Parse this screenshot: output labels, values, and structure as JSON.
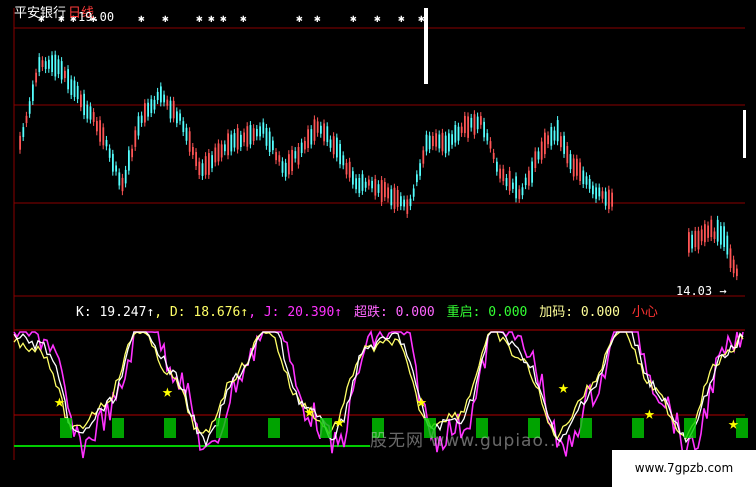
{
  "chart_title": "平安银行",
  "period": "日线",
  "price_high_label": "19.00",
  "price_low_label": "14.03",
  "indicator": {
    "k_label": "K: 19.247↑",
    "d_label": ", D: 18.676↑",
    "j_label": ", J: 20.390↑",
    "chaodie_label": "超跌: 0.000",
    "chongqi_label": "重启: 0.000",
    "jiama_label": "加码: 0.000",
    "xiaoxin_label": "小心"
  },
  "watermark": "股无网 www.gupiao...",
  "site_url": "www.7gpzb.com",
  "colors": {
    "background": "#000000",
    "up_candle": "#ff5555",
    "down_candle": "#54ffff",
    "grid": "#a00000",
    "k_line": "#ffffff",
    "d_line": "#ffff66",
    "j_line": "#ff33ff",
    "star": "#ffff00",
    "baseline": "#00cc00"
  }
}
